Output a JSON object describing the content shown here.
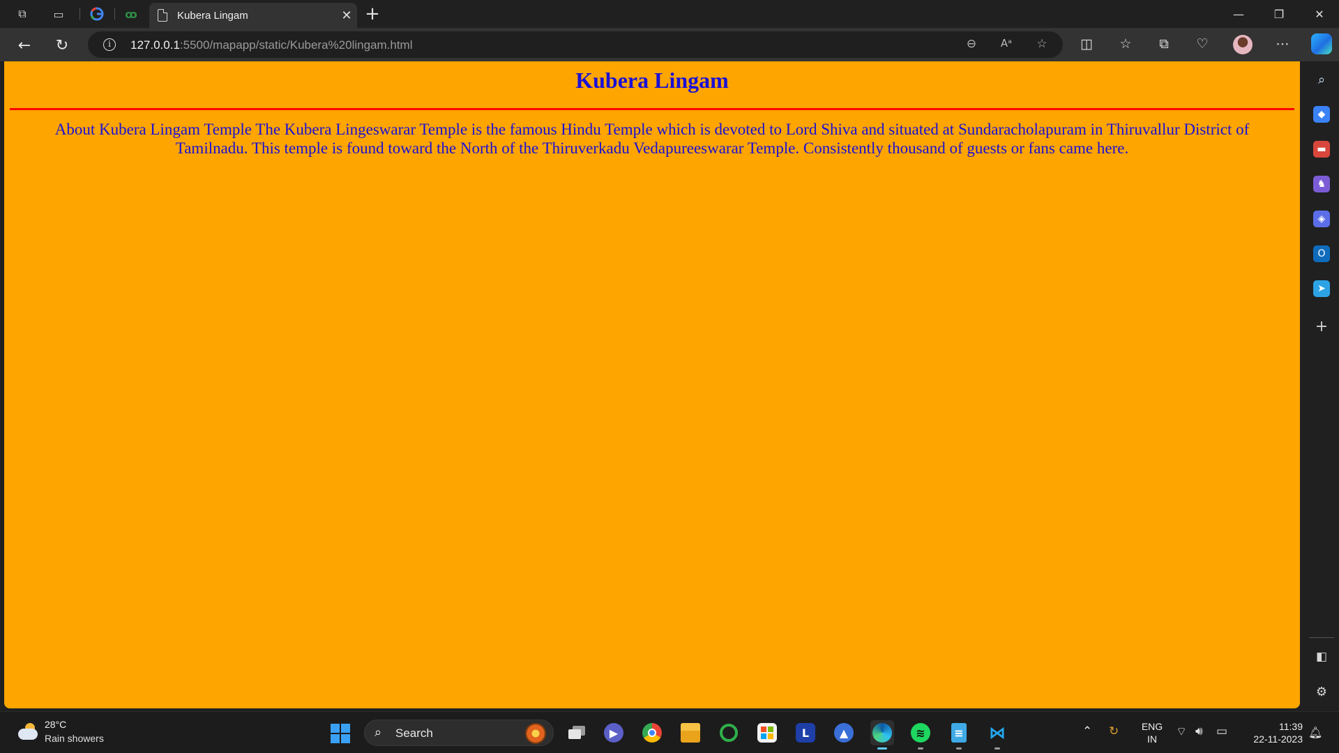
{
  "browser": {
    "tab": {
      "title": "Kubera Lingam",
      "close": "✕"
    },
    "new_tab": "+",
    "window_controls": {
      "minimize": "—",
      "restore": "❐",
      "close": "✕"
    },
    "address": {
      "host": "127.0.0.1",
      "path": ":5500/mapapp/static/Kubera%20lingam.html",
      "info": "i"
    }
  },
  "page": {
    "heading": "Kubera Lingam",
    "paragraph": "About Kubera Lingam Temple The Kubera Lingeswarar Temple is the famous Hindu Temple which is devoted to Lord Shiva and situated at Sundaracholapuram in Thiruvallur District of Tamilnadu. This temple is found toward the North of the Thiruverkadu Vedapureeswarar Temple. Consistently thousand of guests or fans came here.",
    "background_color": "#ffa500",
    "text_color": "#1a10d6",
    "rule_color": "#ff0000"
  },
  "taskbar": {
    "weather": {
      "temp": "28°C",
      "desc": "Rain showers"
    },
    "search_label": "Search",
    "language": {
      "line1": "ENG",
      "line2": "IN"
    },
    "clock": {
      "time": "11:39",
      "date": "22-11-2023"
    },
    "pinned_letter_app": "L"
  }
}
